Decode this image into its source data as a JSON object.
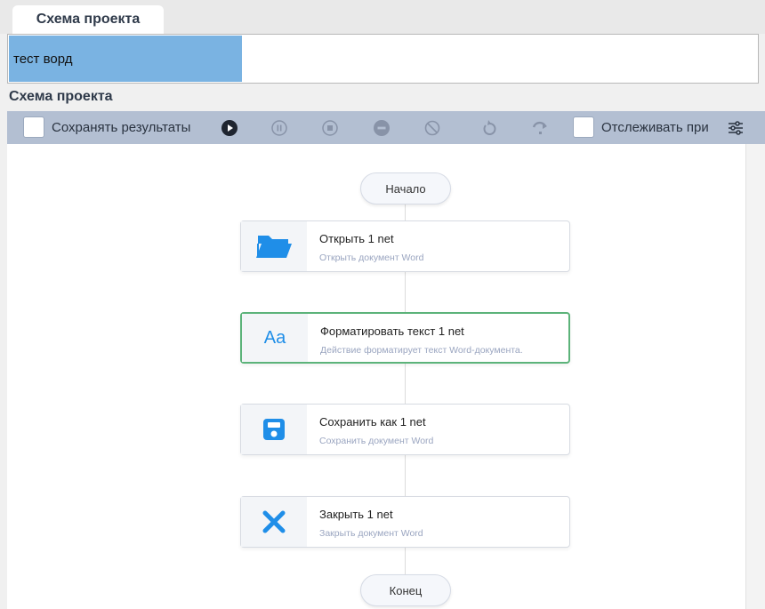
{
  "tab": {
    "label": "Схема проекта"
  },
  "project_list": {
    "selected_item": "тест ворд"
  },
  "section": {
    "title": "Схема проекта"
  },
  "toolbar": {
    "save_results_label": "Сохранять результаты",
    "track_label": "Отслеживать при",
    "icons": [
      "play-icon",
      "pause-icon",
      "stop-icon",
      "stop-all-icon",
      "cancel-icon",
      "undo-icon",
      "redo-icon",
      "settings-icon"
    ]
  },
  "flow": {
    "start_label": "Начало",
    "end_label": "Конец",
    "nodes": [
      {
        "title": "Открыть  1  net",
        "description": "Открыть документ Word",
        "icon": "folder-icon"
      },
      {
        "title": "Форматировать текст  1  net",
        "description": "Действие форматирует текст Word-документа.",
        "icon": "text-format-icon",
        "icon_text": "Aa"
      },
      {
        "title": "Сохранить как  1  net",
        "description": "Сохранить документ Word",
        "icon": "save-icon"
      },
      {
        "title": "Закрыть  1  net",
        "description": "Закрыть документ Word",
        "icon": "close-icon"
      }
    ]
  },
  "colors": {
    "accent": "#1f8ee8",
    "selected": "#7ab3e2",
    "toolbar": "#b3bfd2",
    "active_border": "#5cb37a"
  }
}
